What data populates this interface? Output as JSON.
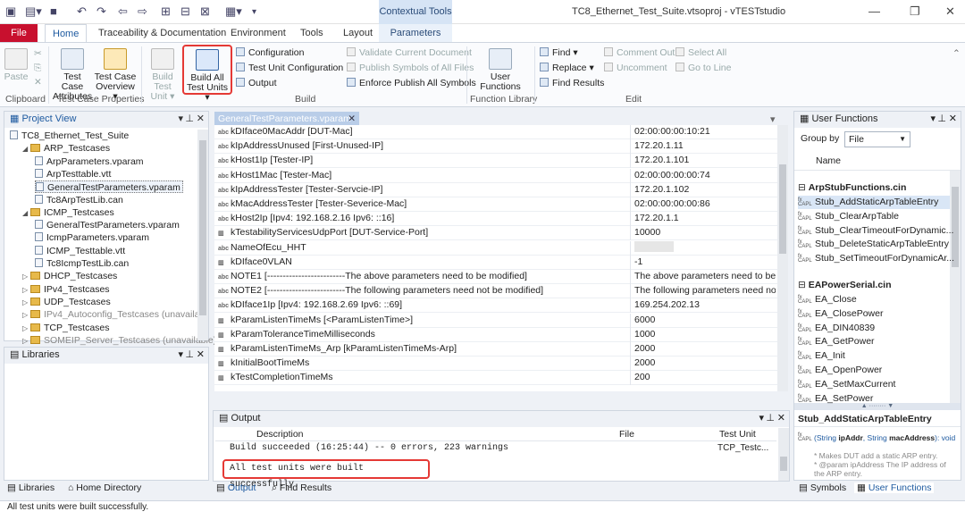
{
  "window": {
    "title": "TC8_Ethernet_Test_Suite.vtsoproj - vTESTstudio",
    "contextual_header": "Contextual Tools"
  },
  "ribbon_tabs": [
    "File",
    "Home",
    "Traceability & Documentation",
    "Environment",
    "Tools",
    "Layout",
    "Parameters"
  ],
  "ribbon": {
    "clipboard": {
      "label": "Clipboard",
      "paste": "Paste"
    },
    "test_case_properties": {
      "label": "Test Case Properties",
      "attributes": [
        "Test Case",
        "Attributes"
      ],
      "overview": [
        "Test Case",
        "Overview"
      ]
    },
    "build": {
      "label": "Build",
      "build_test_unit": [
        "Build Test",
        "Unit"
      ],
      "build_all": [
        "Build All",
        "Test Units"
      ],
      "configuration": "Configuration",
      "test_unit_configuration": "Test Unit Configuration",
      "output": "Output",
      "validate": "Validate Current Document",
      "publish": "Publish Symbols of All Files",
      "enforce": "Enforce Publish All Symbols"
    },
    "function_library": {
      "label": "Function Library",
      "user_functions": [
        "User",
        "Functions"
      ]
    },
    "edit": {
      "label": "Edit",
      "find": "Find",
      "replace": "Replace",
      "find_results": "Find Results",
      "comment_out": "Comment Out",
      "uncomment": "Uncomment",
      "select_all": "Select All",
      "go_to_line": "Go to Line"
    }
  },
  "project_view": {
    "title": "Project View",
    "items": [
      {
        "label": "TC8_Ethernet_Test_Suite",
        "level": 0,
        "kind": "root"
      },
      {
        "label": "ARP_Testcases",
        "level": 1,
        "kind": "folder",
        "expanded": true
      },
      {
        "label": "ArpParameters.vparam",
        "level": 2,
        "kind": "file"
      },
      {
        "label": "ArpTesttable.vtt",
        "level": 2,
        "kind": "file"
      },
      {
        "label": "GeneralTestParameters.vparam",
        "level": 2,
        "kind": "file",
        "selected": true
      },
      {
        "label": "Tc8ArpTestLib.can",
        "level": 2,
        "kind": "file"
      },
      {
        "label": "ICMP_Testcases",
        "level": 1,
        "kind": "folder",
        "expanded": true
      },
      {
        "label": "GeneralTestParameters.vparam",
        "level": 2,
        "kind": "file"
      },
      {
        "label": "IcmpParameters.vparam",
        "level": 2,
        "kind": "file"
      },
      {
        "label": "ICMP_Testtable.vtt",
        "level": 2,
        "kind": "file"
      },
      {
        "label": "Tc8IcmpTestLib.can",
        "level": 2,
        "kind": "file"
      },
      {
        "label": "DHCP_Testcases",
        "level": 1,
        "kind": "folder"
      },
      {
        "label": "IPv4_Testcases",
        "level": 1,
        "kind": "folder"
      },
      {
        "label": "UDP_Testcases",
        "level": 1,
        "kind": "folder"
      },
      {
        "label": "IPv4_Autoconfig_Testcases (unavaila...",
        "level": 1,
        "kind": "folder",
        "dim": true
      },
      {
        "label": "TCP_Testcases",
        "level": 1,
        "kind": "folder"
      },
      {
        "label": "SOMEIP_Server_Testcases (unavailable)",
        "level": 1,
        "kind": "folder",
        "dim": true
      }
    ]
  },
  "libraries": {
    "title": "Libraries"
  },
  "left_bottom_tabs": [
    "Libraries",
    "Home Directory"
  ],
  "editor": {
    "tab": "GeneralTestParameters.vparam",
    "rows": [
      {
        "type": "abc",
        "name": "kDIface0MacAddr [DUT-Mac]",
        "value": "02:00:00:00:10:21"
      },
      {
        "type": "abc",
        "name": "kIpAddressUnused [First-Unused-IP]",
        "value": "172.20.1.11"
      },
      {
        "type": "abc",
        "name": "kHost1Ip [Tester-IP]",
        "value": "172.20.1.101"
      },
      {
        "type": "abc",
        "name": "kHost1Mac [Tester-Mac]",
        "value": "02:00:00:00:00:74"
      },
      {
        "type": "abc",
        "name": "kIpAddressTester [Tester-Servcie-IP]",
        "value": "172.20.1.102"
      },
      {
        "type": "abc",
        "name": "kMacAddressTester [Tester-Severice-Mac]",
        "value": "02:00:00:00:00:86"
      },
      {
        "type": "abc",
        "name": "kHost2Ip [Ipv4: 192.168.2.16 Ipv6: ::16]",
        "value": "172.20.1.1"
      },
      {
        "type": "int",
        "name": "kTestabilityServicesUdpPort [DUT-Service-Port]",
        "value": "10000"
      },
      {
        "type": "abc",
        "name": "NameOfEcu_HHT",
        "value": ""
      },
      {
        "type": "int",
        "name": "kDIface0VLAN",
        "value": "-1"
      },
      {
        "type": "abc",
        "name": "NOTE1 [-------------------------The above parameters need to be modified]",
        "value": "The above parameters need to be m"
      },
      {
        "type": "abc",
        "name": "NOTE2 [-------------------------The following parameters need not be modified]",
        "value": "The following parameters need not b"
      },
      {
        "type": "abc",
        "name": "kDIface1Ip [Ipv4: 192.168.2.69 Ipv6: ::69]",
        "value": "169.254.202.13"
      },
      {
        "type": "int",
        "name": "kParamListenTimeMs [<ParamListenTime>]",
        "value": "6000"
      },
      {
        "type": "int",
        "name": "kParamToleranceTimeMilliseconds",
        "value": "1000"
      },
      {
        "type": "int",
        "name": "kParamListenTimeMs_Arp [kParamListenTimeMs-Arp]",
        "value": "2000"
      },
      {
        "type": "int",
        "name": "kInitialBootTimeMs",
        "value": "2000"
      },
      {
        "type": "int",
        "name": "kTestCompletionTimeMs",
        "value": "200"
      }
    ]
  },
  "output": {
    "title": "Output",
    "columns": [
      "Description",
      "File",
      "Test Unit"
    ],
    "lines": [
      {
        "description": "Build succeeded (16:25:44) -- 0 errors, 223 warnings",
        "file": "",
        "test_unit": "TCP_Testc..."
      },
      {
        "description": "All test units were built successfully.",
        "file": "",
        "test_unit": ""
      }
    ],
    "tabs": [
      "Output",
      "Find Results"
    ]
  },
  "user_functions": {
    "title": "User Functions",
    "group_by_label": "Group by",
    "group_by_value": "File",
    "column": "Name",
    "groups": [
      {
        "name": "ArpStubFunctions.cin",
        "items": [
          "Stub_AddStaticArpTableEntry",
          "Stub_ClearArpTable",
          "Stub_ClearTimeoutForDynamic...",
          "Stub_DeleteStaticArpTableEntry",
          "Stub_SetTimeoutForDynamicAr..."
        ]
      },
      {
        "name": "EAPowerSerial.cin",
        "items": [
          "EA_Close",
          "EA_ClosePower",
          "EA_DIN40839",
          "EA_GetPower",
          "EA_Init",
          "EA_OpenPower",
          "EA_SetMaxCurrent",
          "EA_SetPower"
        ]
      }
    ],
    "detail": {
      "title": "Stub_AddStaticArpTableEntry",
      "signature_pre": "(String ",
      "param1": "ipAddr",
      "mid": ", String ",
      "param2": "macAddress",
      "post": "): void",
      "comment1": "* Makes DUT add a static ARP entry.",
      "comment2": "* @param ipAddress The IP address of the ARP entry."
    },
    "tabs": [
      "Symbols",
      "User Functions"
    ]
  },
  "status": {
    "text": "All test units were built successfully."
  }
}
